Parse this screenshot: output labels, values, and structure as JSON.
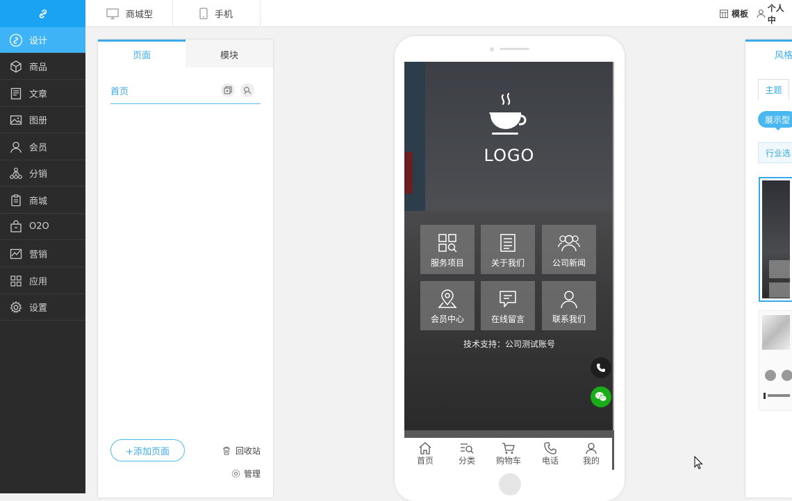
{
  "sidebar": {
    "items": [
      {
        "label": "设计",
        "icon": "design-icon"
      },
      {
        "label": "商品",
        "icon": "box-icon"
      },
      {
        "label": "文章",
        "icon": "article-icon"
      },
      {
        "label": "图册",
        "icon": "album-icon"
      },
      {
        "label": "会员",
        "icon": "user-icon"
      },
      {
        "label": "分销",
        "icon": "distribution-icon"
      },
      {
        "label": "商城",
        "icon": "clipboard-icon"
      },
      {
        "label": "O2O",
        "icon": "shop-icon"
      },
      {
        "label": "营销",
        "icon": "chart-icon"
      },
      {
        "label": "应用",
        "icon": "apps-icon"
      },
      {
        "label": "设置",
        "icon": "gear-icon"
      }
    ]
  },
  "topbar": {
    "tabs": [
      "商城型",
      "手机"
    ],
    "template_label": "模板",
    "user_label": "个人中"
  },
  "left_panel": {
    "tabs": [
      "页面",
      "模块"
    ],
    "page_item": "首页",
    "add_page": "+添加页面",
    "recycle": "回收站",
    "manage": "管理"
  },
  "phone": {
    "logo_text": "LOGO",
    "grid": [
      "服务项目",
      "关于我们",
      "公司新闻",
      "会员中心",
      "在线留言",
      "联系我们"
    ],
    "support_text": "技术支持：公司测试账号",
    "tabbar": [
      "首页",
      "分类",
      "购物车",
      "电话",
      "我的"
    ]
  },
  "right_panel": {
    "tab": "风格",
    "sub_tab": "主题",
    "badge": "展示型",
    "industry": "行业选"
  },
  "colors": {
    "accent": "#1aa3f2",
    "sidebar_bg": "#2b2b2b",
    "wechat": "#1aad19"
  }
}
